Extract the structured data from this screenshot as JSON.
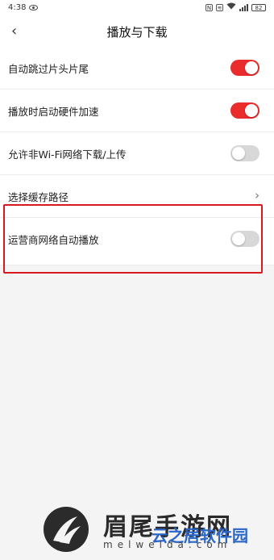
{
  "status_bar": {
    "time": "4:38",
    "battery": "82"
  },
  "header": {
    "back_symbol": "‹",
    "title": "播放与下载"
  },
  "settings": [
    {
      "label": "自动跳过片头片尾",
      "control": "toggle",
      "on": true
    },
    {
      "label": "播放时启动硬件加速",
      "control": "toggle",
      "on": true
    },
    {
      "label": "允许非Wi-Fi网络下载/上传",
      "control": "toggle",
      "on": false
    },
    {
      "label": "选择缓存路径",
      "control": "chevron"
    },
    {
      "label": "运营商网络自动播放",
      "control": "toggle",
      "on": false
    }
  ],
  "colors": {
    "accent": "#ea2c2c",
    "highlight": "#d9191f",
    "toggle_off": "#d8d8d8"
  },
  "watermark": {
    "line1": "眉尾手游网",
    "line2": "melwelda.com",
    "line3": "云之居软件园"
  }
}
